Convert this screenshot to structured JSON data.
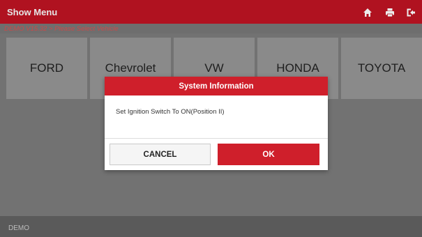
{
  "header": {
    "title": "Show Menu",
    "icons": [
      "home-icon",
      "print-icon",
      "exit-icon"
    ]
  },
  "breadcrumb": "DEMO V15.32 > Please Select  Vehicle",
  "vehicles": [
    {
      "label": "FORD"
    },
    {
      "label": "Chevrolet"
    },
    {
      "label": "VW"
    },
    {
      "label": "HONDA"
    },
    {
      "label": "TOYOTA"
    }
  ],
  "dialog": {
    "title": "System Information",
    "message": "Set Ignition Switch To ON(Position II)",
    "cancel_label": "CANCEL",
    "ok_label": "OK"
  },
  "footer": {
    "text": "DEMO"
  },
  "colors": {
    "brand_red": "#cf1f2b",
    "titlebar_red": "#b01220",
    "overlay_gray": "#727272"
  }
}
